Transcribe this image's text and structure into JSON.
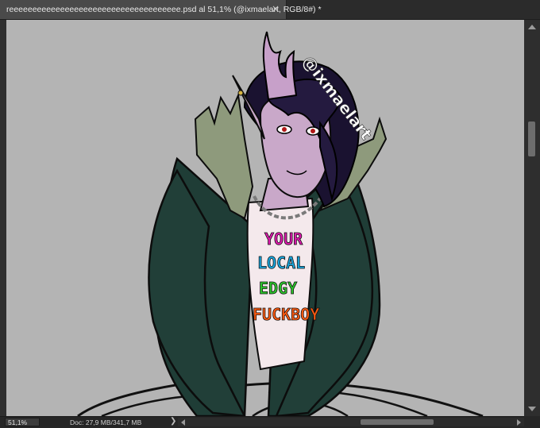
{
  "document_tab": {
    "title": "reeeeeeeeeeeeeeeeeeeeeeeeeeeeeeeeeeeee.psd al 51,1% (@ixmaelart, RGB/8#) *",
    "close_glyph": "×"
  },
  "canvas": {
    "background_color": "#b4b4b4",
    "artwork": {
      "watermark": "@ixmaelart",
      "shirt_text": [
        "YOUR",
        "LOCAL",
        "EDGY",
        "FUCKBOY"
      ],
      "shirt_text_colors": [
        "#e01ab0",
        "#1aa8e0",
        "#2cc72c",
        "#ff5a10"
      ]
    }
  },
  "status_bar": {
    "zoom": "51,1%",
    "doc_info": "Doc: 27,9 MB/341,7 MB",
    "chevron": "❯"
  }
}
